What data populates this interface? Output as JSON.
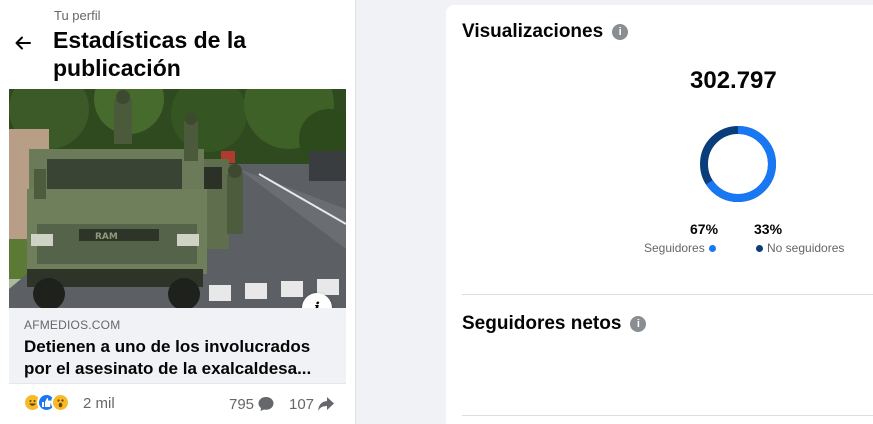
{
  "header": {
    "breadcrumb": "Tu perfil",
    "title": "Estadísticas de la publicación"
  },
  "post": {
    "image_alt": "Militares sobre camionetas en una calle",
    "link_domain": "AFMEDIOS.COM",
    "link_title": "Detienen a uno de los involucrados por el asesinato de la exalcaldesa...",
    "info_label": "i",
    "reactions_count": "2 mil",
    "comments_count": "795",
    "shares_count": "107"
  },
  "views": {
    "title": "Visualizaciones",
    "total": "302.797",
    "followers_pct": "67%",
    "non_followers_pct": "33%",
    "followers_label": "Seguidores",
    "non_followers_label": "No seguidores",
    "followers_fraction": 0.67,
    "followers_color": "#1877f2",
    "non_followers_color": "#0a3d7a"
  },
  "net_followers": {
    "title": "Seguidores netos"
  },
  "icons": {
    "back": "arrow-left-icon",
    "help": "info-circle-icon",
    "comment": "speech-bubble-icon",
    "share": "share-arrow-icon",
    "reactions": [
      "haha-icon",
      "like-icon",
      "wow-icon"
    ]
  }
}
